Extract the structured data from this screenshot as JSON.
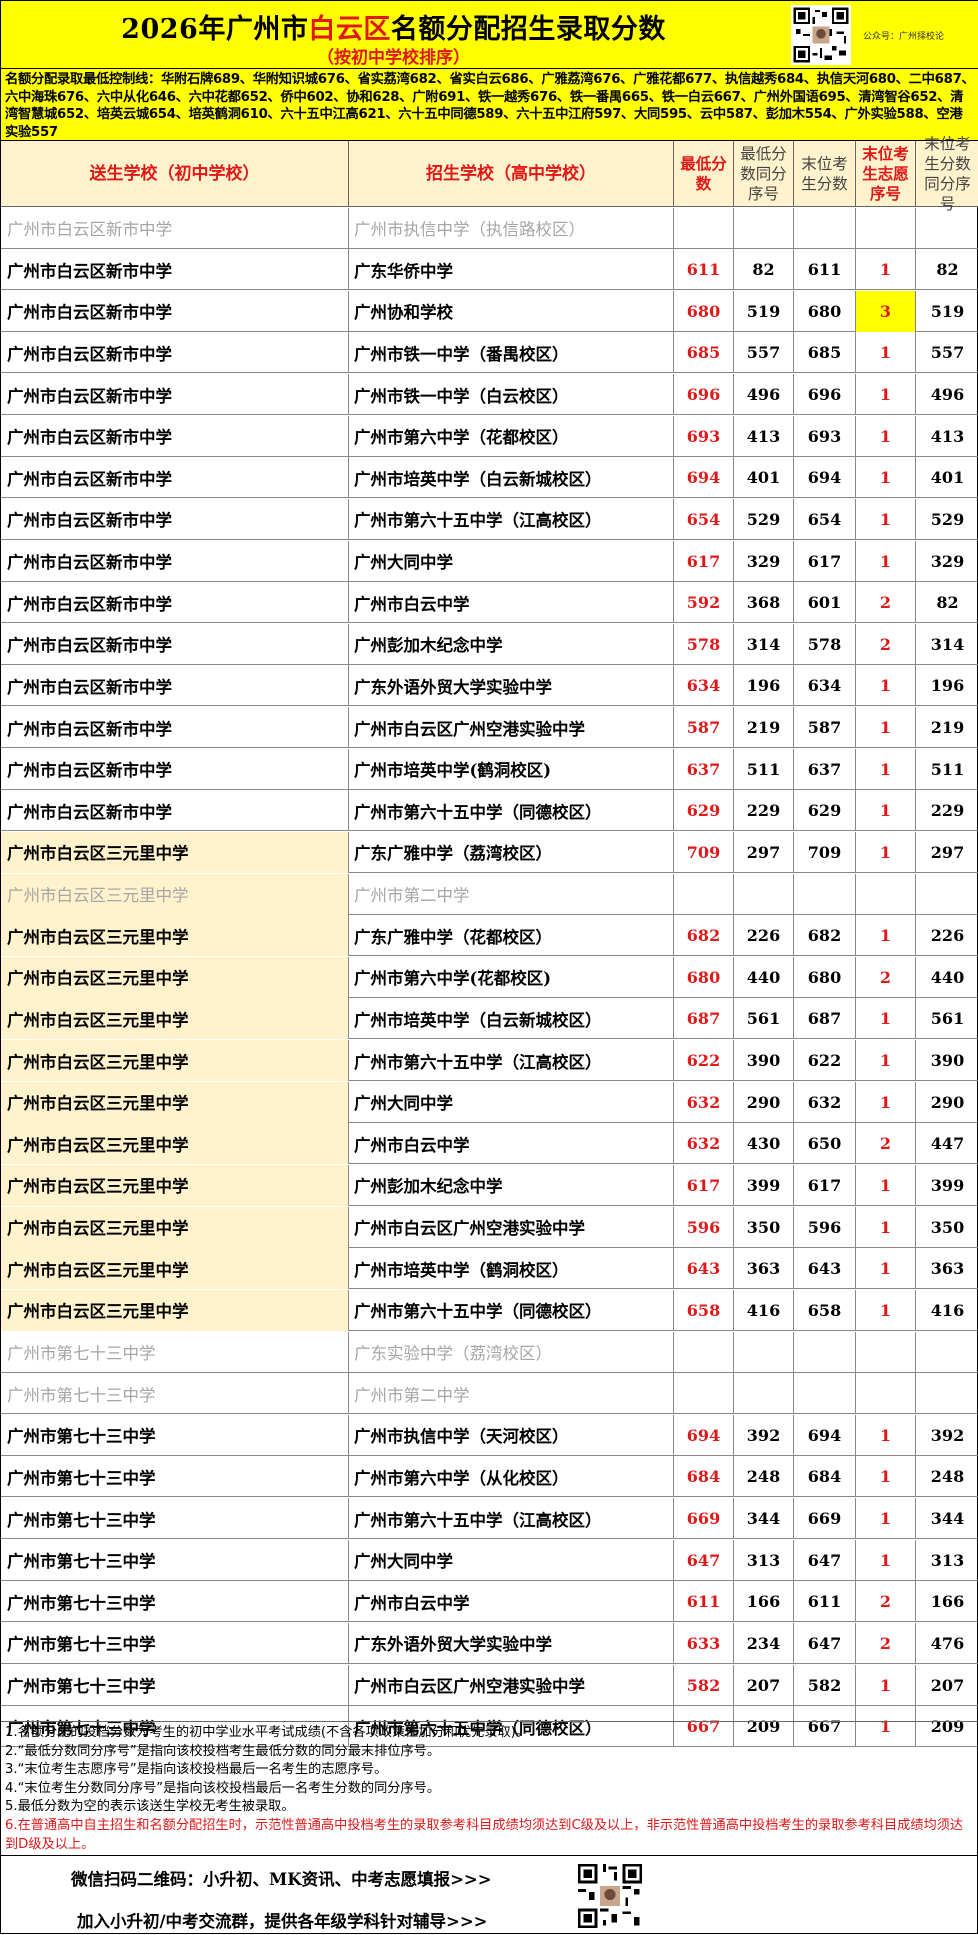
{
  "header": {
    "title_pre": "2026年广州市",
    "title_hl": "白云区",
    "title_post": "名额分配招生录取分数",
    "subtitle": "（按初中学校排序）",
    "gzh_label": "公众号：广州择校论"
  },
  "control_text": "名额分配录取最低控制线：华附石牌689、华附知识城676、省实荔湾682、省实白云686、广雅荔湾676、广雅花都677、执信越秀684、执信天河680、二中687、六中海珠676、六中从化646、六中花都652、侨中602、协和628、广附691、铁一越秀676、铁一番禺665、铁一白云667、广州外国语695、清湾智谷652、清湾智慧城652、培英云城654、培英鹤洞610、六十五中江高621、六十五中同德589、六十五中江府597、大同595、云中587、彭加木554、广外实验588、空港实验557",
  "table": {
    "headers": {
      "from": "送生学校（初中学校）",
      "to": "招生学校（高中学校）",
      "min": "最低分数",
      "min_rank": "最低分数同分序号",
      "last": "末位考生分数",
      "vol": "末位考生志愿序号",
      "last_rank": "末位考生分数同分序号"
    },
    "rows": [
      {
        "from": "广州市白云区新市中学",
        "to": "广州市执信中学（执信路校区）",
        "min": "",
        "min_rank": "",
        "last": "",
        "vol": "",
        "last_rank": ""
      },
      {
        "from": "广州市白云区新市中学",
        "to": "广东华侨中学",
        "min": "611",
        "min_rank": "82",
        "last": "611",
        "vol": "1",
        "last_rank": "82"
      },
      {
        "from": "广州市白云区新市中学",
        "to": "广州协和学校",
        "min": "680",
        "min_rank": "519",
        "last": "680",
        "vol": "3",
        "last_rank": "519"
      },
      {
        "from": "广州市白云区新市中学",
        "to": "广州市铁一中学（番禺校区）",
        "min": "685",
        "min_rank": "557",
        "last": "685",
        "vol": "1",
        "last_rank": "557"
      },
      {
        "from": "广州市白云区新市中学",
        "to": "广州市铁一中学（白云校区）",
        "min": "696",
        "min_rank": "496",
        "last": "696",
        "vol": "1",
        "last_rank": "496"
      },
      {
        "from": "广州市白云区新市中学",
        "to": "广州市第六中学（花都校区）",
        "min": "693",
        "min_rank": "413",
        "last": "693",
        "vol": "1",
        "last_rank": "413"
      },
      {
        "from": "广州市白云区新市中学",
        "to": "广州市培英中学（白云新城校区）",
        "min": "694",
        "min_rank": "401",
        "last": "694",
        "vol": "1",
        "last_rank": "401"
      },
      {
        "from": "广州市白云区新市中学",
        "to": "广州市第六十五中学（江高校区）",
        "min": "654",
        "min_rank": "529",
        "last": "654",
        "vol": "1",
        "last_rank": "529"
      },
      {
        "from": "广州市白云区新市中学",
        "to": "广州大同中学",
        "min": "617",
        "min_rank": "329",
        "last": "617",
        "vol": "1",
        "last_rank": "329"
      },
      {
        "from": "广州市白云区新市中学",
        "to": "广州市白云中学",
        "min": "592",
        "min_rank": "368",
        "last": "601",
        "vol": "2",
        "last_rank": "82"
      },
      {
        "from": "广州市白云区新市中学",
        "to": "广州彭加木纪念中学",
        "min": "578",
        "min_rank": "314",
        "last": "578",
        "vol": "2",
        "last_rank": "314"
      },
      {
        "from": "广州市白云区新市中学",
        "to": "广东外语外贸大学实验中学",
        "min": "634",
        "min_rank": "196",
        "last": "634",
        "vol": "1",
        "last_rank": "196"
      },
      {
        "from": "广州市白云区新市中学",
        "to": "广州市白云区广州空港实验中学",
        "min": "587",
        "min_rank": "219",
        "last": "587",
        "vol": "1",
        "last_rank": "219"
      },
      {
        "from": "广州市白云区新市中学",
        "to": "广州市培英中学(鹤洞校区)",
        "min": "637",
        "min_rank": "511",
        "last": "637",
        "vol": "1",
        "last_rank": "511"
      },
      {
        "from": "广州市白云区新市中学",
        "to": "广州市第六十五中学（同德校区）",
        "min": "629",
        "min_rank": "229",
        "last": "629",
        "vol": "1",
        "last_rank": "229"
      },
      {
        "from": "广州市白云区三元里中学",
        "to": "广东广雅中学（荔湾校区）",
        "min": "709",
        "min_rank": "297",
        "last": "709",
        "vol": "1",
        "last_rank": "297"
      },
      {
        "from": "广州市白云区三元里中学",
        "to": "广州市第二中学",
        "min": "",
        "min_rank": "",
        "last": "",
        "vol": "",
        "last_rank": ""
      },
      {
        "from": "广州市白云区三元里中学",
        "to": "广东广雅中学（花都校区）",
        "min": "682",
        "min_rank": "226",
        "last": "682",
        "vol": "1",
        "last_rank": "226"
      },
      {
        "from": "广州市白云区三元里中学",
        "to": "广州市第六中学(花都校区)",
        "min": "680",
        "min_rank": "440",
        "last": "680",
        "vol": "2",
        "last_rank": "440"
      },
      {
        "from": "广州市白云区三元里中学",
        "to": "广州市培英中学（白云新城校区）",
        "min": "687",
        "min_rank": "561",
        "last": "687",
        "vol": "1",
        "last_rank": "561"
      },
      {
        "from": "广州市白云区三元里中学",
        "to": "广州市第六十五中学（江高校区）",
        "min": "622",
        "min_rank": "390",
        "last": "622",
        "vol": "1",
        "last_rank": "390"
      },
      {
        "from": "广州市白云区三元里中学",
        "to": "广州大同中学",
        "min": "632",
        "min_rank": "290",
        "last": "632",
        "vol": "1",
        "last_rank": "290"
      },
      {
        "from": "广州市白云区三元里中学",
        "to": "广州市白云中学",
        "min": "632",
        "min_rank": "430",
        "last": "650",
        "vol": "2",
        "last_rank": "447"
      },
      {
        "from": "广州市白云区三元里中学",
        "to": "广州彭加木纪念中学",
        "min": "617",
        "min_rank": "399",
        "last": "617",
        "vol": "1",
        "last_rank": "399"
      },
      {
        "from": "广州市白云区三元里中学",
        "to": "广州市白云区广州空港实验中学",
        "min": "596",
        "min_rank": "350",
        "last": "596",
        "vol": "1",
        "last_rank": "350"
      },
      {
        "from": "广州市白云区三元里中学",
        "to": "广州市培英中学（鹤洞校区）",
        "min": "643",
        "min_rank": "363",
        "last": "643",
        "vol": "1",
        "last_rank": "363"
      },
      {
        "from": "广州市白云区三元里中学",
        "to": "广州市第六十五中学（同德校区）",
        "min": "658",
        "min_rank": "416",
        "last": "658",
        "vol": "1",
        "last_rank": "416"
      },
      {
        "from": "广州市第七十三中学",
        "to": "广东实验中学（荔湾校区）",
        "min": "",
        "min_rank": "",
        "last": "",
        "vol": "",
        "last_rank": ""
      },
      {
        "from": "广州市第七十三中学",
        "to": "广州市第二中学",
        "min": "",
        "min_rank": "",
        "last": "",
        "vol": "",
        "last_rank": ""
      },
      {
        "from": "广州市第七十三中学",
        "to": "广州市执信中学（天河校区）",
        "min": "694",
        "min_rank": "392",
        "last": "694",
        "vol": "1",
        "last_rank": "392"
      },
      {
        "from": "广州市第七十三中学",
        "to": "广州市第六中学（从化校区）",
        "min": "684",
        "min_rank": "248",
        "last": "684",
        "vol": "1",
        "last_rank": "248"
      },
      {
        "from": "广州市第七十三中学",
        "to": "广州市第六十五中学（江高校区）",
        "min": "669",
        "min_rank": "344",
        "last": "669",
        "vol": "1",
        "last_rank": "344"
      },
      {
        "from": "广州市第七十三中学",
        "to": "广州大同中学",
        "min": "647",
        "min_rank": "313",
        "last": "647",
        "vol": "1",
        "last_rank": "313"
      },
      {
        "from": "广州市第七十三中学",
        "to": "广州市白云中学",
        "min": "611",
        "min_rank": "166",
        "last": "611",
        "vol": "2",
        "last_rank": "166"
      },
      {
        "from": "广州市第七十三中学",
        "to": "广东外语外贸大学实验中学",
        "min": "633",
        "min_rank": "234",
        "last": "647",
        "vol": "2",
        "last_rank": "476"
      },
      {
        "from": "广州市第七十三中学",
        "to": "广州市白云区广州空港实验中学",
        "min": "582",
        "min_rank": "207",
        "last": "582",
        "vol": "1",
        "last_rank": "207"
      },
      {
        "from": "广州市第七十三中学",
        "to": "广州市第六十五中学（同德校区）",
        "min": "667",
        "min_rank": "209",
        "last": "667",
        "vol": "1",
        "last_rank": "209"
      }
    ]
  },
  "notes": [
    "1.名额分配的投档分数为考生的初中学业水平考试成绩(不含各项政策性加分和优先录取)。",
    "2.“最低分数同分序号”是指向该校投档考生最低分数的同分最末排位序号。",
    "3.“末位考生志愿序号”是指向该校投档最后一名考生的志愿序号。",
    "4.“末位考生分数同分序号”是指向该校投档最后一名考生分数的同分序号。",
    "5.最低分数为空的表示该送生学校无考生被录取。"
  ],
  "note_red": "6.在普通高中自主招生和名额分配招生时，示范性普通高中投档考生的录取参考科目成绩均须达到C级及以上，非示范性普通高中投档考生的录取参考科目成绩均须达到D级及以上。",
  "footer": {
    "line1": "微信扫码二维码：小升初、MK资讯、中考志愿填报>>>",
    "line2": "加入小升初/中考交流群，提供各年级学科针对辅导>>>"
  }
}
